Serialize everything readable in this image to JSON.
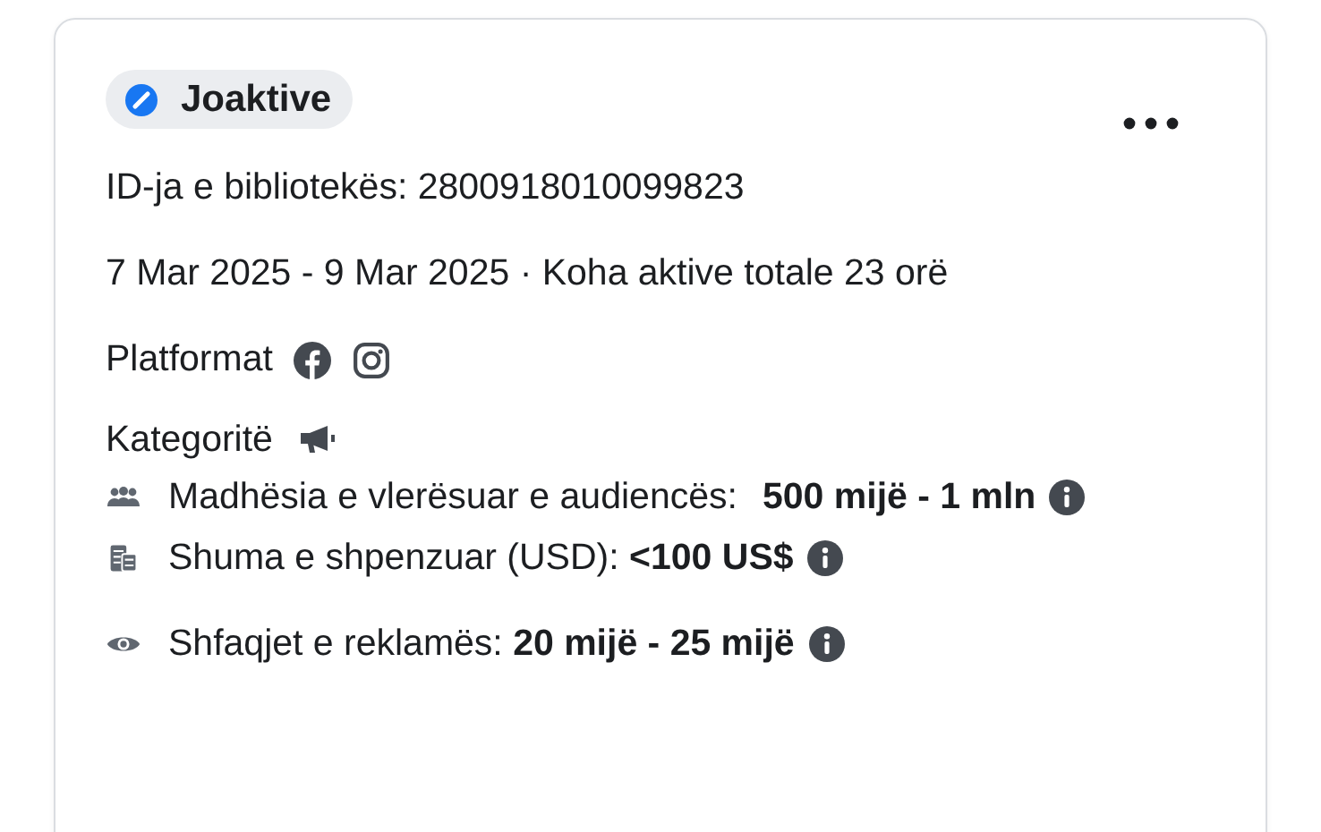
{
  "status": {
    "label": "Joaktive"
  },
  "library_id": "ID-ja e bibliotekës: 2800918010099823",
  "dates": "7 Mar 2025 - 9 Mar 2025 · Koha aktive totale 23 orë",
  "platforms": {
    "label": "Platformat",
    "items": [
      {
        "kind": "facebook"
      },
      {
        "kind": "instagram"
      }
    ]
  },
  "categories": {
    "label": "Kategoritë"
  },
  "metrics": [
    {
      "kind": "audience",
      "label": "Madhësia e vlerësuar e audiencës:",
      "value": "500 mijë - 1 mln"
    },
    {
      "kind": "spend",
      "label": "Shuma e shpenzuar (USD):",
      "value": "<100 US$"
    },
    {
      "kind": "impressions",
      "label": "Shfaqjet e reklamës:",
      "value": "20 mijë - 25 mijë"
    }
  ]
}
